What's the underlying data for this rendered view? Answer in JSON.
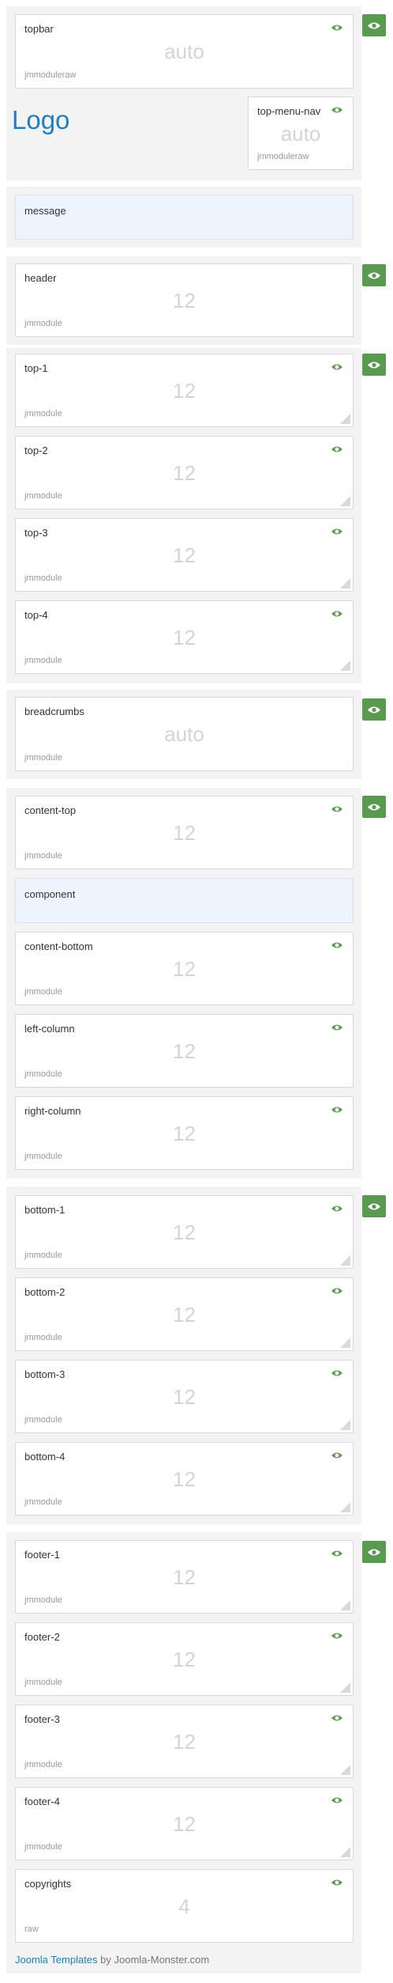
{
  "logo_text": "Logo",
  "credits": {
    "link": "Joomla Templates",
    "suffix": " by Joomla-Monster.com"
  },
  "colors": {
    "toggle": "#5a9a50",
    "eye": "#5a9a50",
    "logo": "#1f7fc4",
    "panel": "#f3f3f3",
    "component_bg": "#eef4fd"
  },
  "toggle_icon": "eye-icon",
  "sections": {
    "topbar": {
      "name": "topbar",
      "span": "auto",
      "type": "jmmoduleraw"
    },
    "top_menu_nav": {
      "name": "top-menu-nav",
      "span": "auto",
      "type": "jmmoduleraw"
    },
    "message": {
      "name": "message"
    },
    "header": {
      "name": "header",
      "span": "12",
      "type": "jmmodule"
    },
    "top": [
      {
        "name": "top-1",
        "span": "12",
        "type": "jmmodule"
      },
      {
        "name": "top-2",
        "span": "12",
        "type": "jmmodule"
      },
      {
        "name": "top-3",
        "span": "12",
        "type": "jmmodule"
      },
      {
        "name": "top-4",
        "span": "12",
        "type": "jmmodule"
      }
    ],
    "breadcrumbs": {
      "name": "breadcrumbs",
      "span": "auto",
      "type": "jmmodule"
    },
    "content_top": {
      "name": "content-top",
      "span": "12",
      "type": "jmmodule"
    },
    "component": {
      "name": "component"
    },
    "content_bottom": {
      "name": "content-bottom",
      "span": "12",
      "type": "jmmodule"
    },
    "left_column": {
      "name": "left-column",
      "span": "12",
      "type": "jmmodule"
    },
    "right_column": {
      "name": "right-column",
      "span": "12",
      "type": "jmmodule"
    },
    "bottom": [
      {
        "name": "bottom-1",
        "span": "12",
        "type": "jmmodule"
      },
      {
        "name": "bottom-2",
        "span": "12",
        "type": "jmmodule"
      },
      {
        "name": "bottom-3",
        "span": "12",
        "type": "jmmodule"
      },
      {
        "name": "bottom-4",
        "span": "12",
        "type": "jmmodule"
      }
    ],
    "footer": [
      {
        "name": "footer-1",
        "span": "12",
        "type": "jmmodule"
      },
      {
        "name": "footer-2",
        "span": "12",
        "type": "jmmodule"
      },
      {
        "name": "footer-3",
        "span": "12",
        "type": "jmmodule"
      },
      {
        "name": "footer-4",
        "span": "12",
        "type": "jmmodule"
      }
    ],
    "copyrights": {
      "name": "copyrights",
      "span": "4",
      "type": "raw"
    }
  }
}
